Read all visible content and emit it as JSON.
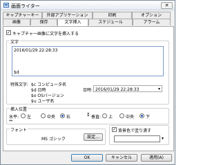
{
  "window": {
    "title": "画面ライター",
    "close_label": "✕"
  },
  "tabs_row1": [
    "キャプチャーキー",
    "外部アプリケーション",
    "印刷",
    "オプション"
  ],
  "tabs_row2": [
    "画像",
    "保存",
    "文字挿入",
    "スケジュール",
    "アラーム"
  ],
  "insert_text_checkbox": {
    "label": "キャプチャー画像に文字を挿入する",
    "checked": true
  },
  "text_group": {
    "label": "文字",
    "textbox_lines": [
      "2016/01/29 22:28:33",
      "",
      "",
      "$d"
    ],
    "special_chars_label": "特殊文字:",
    "special_chars": [
      "$c コンピュータ名",
      "$d 日時",
      "$o OSバージョン",
      "$u ユーザ名"
    ],
    "datetime_label": "日時:",
    "datetime_value": "2016/01/29 22:28:33"
  },
  "position_group": {
    "label": "挿入位置",
    "horizontal_label": "水平:",
    "horizontal_options": [
      "左",
      "中央",
      "右"
    ],
    "horizontal_selected": "右",
    "vertical_label": "垂直:",
    "vertical_options": [
      "上",
      "中央",
      "下"
    ],
    "vertical_selected": "下"
  },
  "font_group": {
    "label": "フォント",
    "font_name": "MS ゴシック",
    "settings_button": "設定..."
  },
  "background_fill": {
    "label": "背景色で塗り潰す",
    "checked": true,
    "color": "#ffffff"
  },
  "buttons": {
    "ok": "OK",
    "cancel": "キャンセル",
    "apply": "適用(A)"
  }
}
